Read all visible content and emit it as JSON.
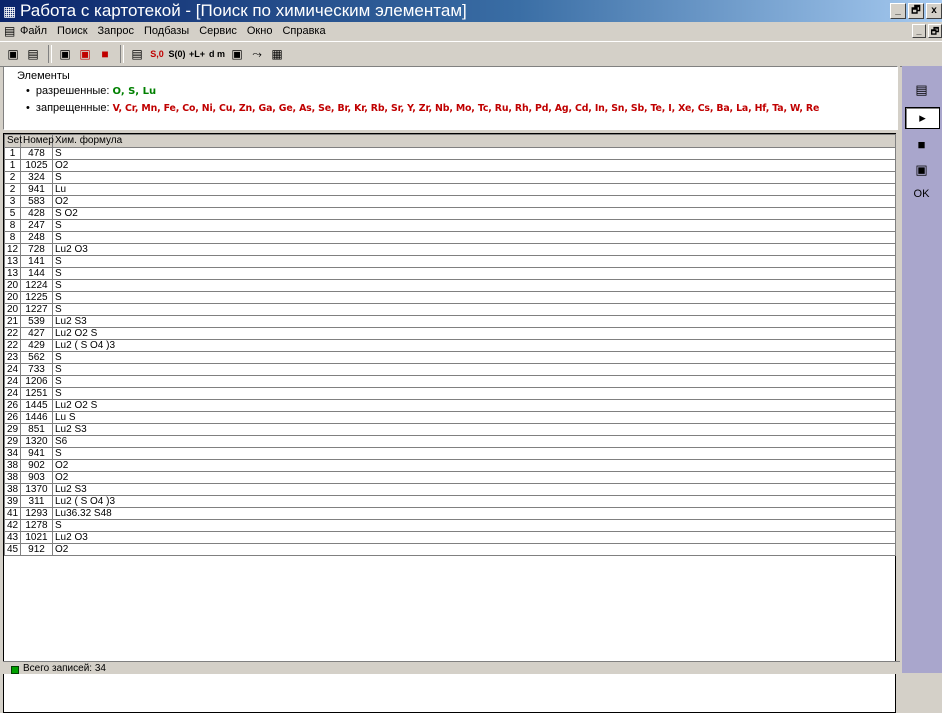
{
  "window": {
    "title": "Работа с картотекой - [Поиск по химическим элементам]",
    "controls": [
      "_",
      "🗗",
      "x"
    ]
  },
  "menu": {
    "items": [
      "Файл",
      "Поиск",
      "Запрос",
      "Подбазы",
      "Сервис",
      "Окно",
      "Справка"
    ],
    "mdi_controls": [
      "_",
      "🗗",
      "x"
    ]
  },
  "toolbar": {
    "buttons": [
      "open-db-icon",
      "folder-icon",
      "copy-icon",
      "delete-icon",
      "stop-icon",
      "print-icon",
      "so-icon",
      "s0-icon",
      "plus-l-icon",
      "dm-icon",
      "grid-icon",
      "tree-icon",
      "table-icon"
    ],
    "labels": {
      "so": "S,0",
      "s0": "S(0)",
      "plusl": "+L+",
      "dm": "d m"
    }
  },
  "elements": {
    "header": "Элементы",
    "allowed_label": "разрешенные:",
    "allowed": "O, S, Lu",
    "forbidden_label": "запрещенные:",
    "forbidden": "V, Cr, Mn, Fe, Co, Ni, Cu, Zn, Ga, Ge, As, Se, Br, Kr, Rb, Sr, Y, Zr, Nb, Mo, Tc, Ru, Rh, Pd, Ag, Cd, In, Sn, Sb, Te, I, Xe, Cs, Ba, La, Hf, Ta, W, Re"
  },
  "table": {
    "columns": [
      "Set",
      "Номер",
      "Хим. формула"
    ],
    "rows": [
      [
        "1",
        "478",
        "S"
      ],
      [
        "1",
        "1025",
        "O2"
      ],
      [
        "2",
        "324",
        "S"
      ],
      [
        "2",
        "941",
        "Lu"
      ],
      [
        "3",
        "583",
        "O2"
      ],
      [
        "5",
        "428",
        "S O2"
      ],
      [
        "8",
        "247",
        "S"
      ],
      [
        "8",
        "248",
        "S"
      ],
      [
        "12",
        "728",
        "Lu2 O3"
      ],
      [
        "13",
        "141",
        "S"
      ],
      [
        "13",
        "144",
        "S"
      ],
      [
        "20",
        "1224",
        "S"
      ],
      [
        "20",
        "1225",
        "S"
      ],
      [
        "20",
        "1227",
        "S"
      ],
      [
        "21",
        "539",
        "Lu2 S3"
      ],
      [
        "22",
        "427",
        "Lu2 O2 S"
      ],
      [
        "22",
        "429",
        "Lu2 ( S O4 )3"
      ],
      [
        "23",
        "562",
        "S"
      ],
      [
        "24",
        "733",
        "S"
      ],
      [
        "24",
        "1206",
        "S"
      ],
      [
        "24",
        "1251",
        "S"
      ],
      [
        "26",
        "1445",
        "Lu2 O2 S"
      ],
      [
        "26",
        "1446",
        "Lu S"
      ],
      [
        "29",
        "851",
        "Lu2 S3"
      ],
      [
        "29",
        "1320",
        "S6"
      ],
      [
        "34",
        "941",
        "S"
      ],
      [
        "38",
        "902",
        "O2"
      ],
      [
        "38",
        "903",
        "O2"
      ],
      [
        "38",
        "1370",
        "Lu2 S3"
      ],
      [
        "39",
        "311",
        "Lu2 ( S O4 )3"
      ],
      [
        "41",
        "1293",
        "Lu36.32 S48"
      ],
      [
        "42",
        "1278",
        "S"
      ],
      [
        "43",
        "1021",
        "Lu2 O3"
      ],
      [
        "45",
        "912",
        "O2"
      ]
    ]
  },
  "status": {
    "text": "Всего записей: 34"
  },
  "side_panel": {
    "buttons": [
      "properties-icon",
      "play-icon",
      "save-icon",
      "database-icon"
    ],
    "ok_label": "OK"
  },
  "colors": {
    "allowed": "#008000",
    "forbidden": "#c00000",
    "side_panel": "#a9a6cc"
  }
}
